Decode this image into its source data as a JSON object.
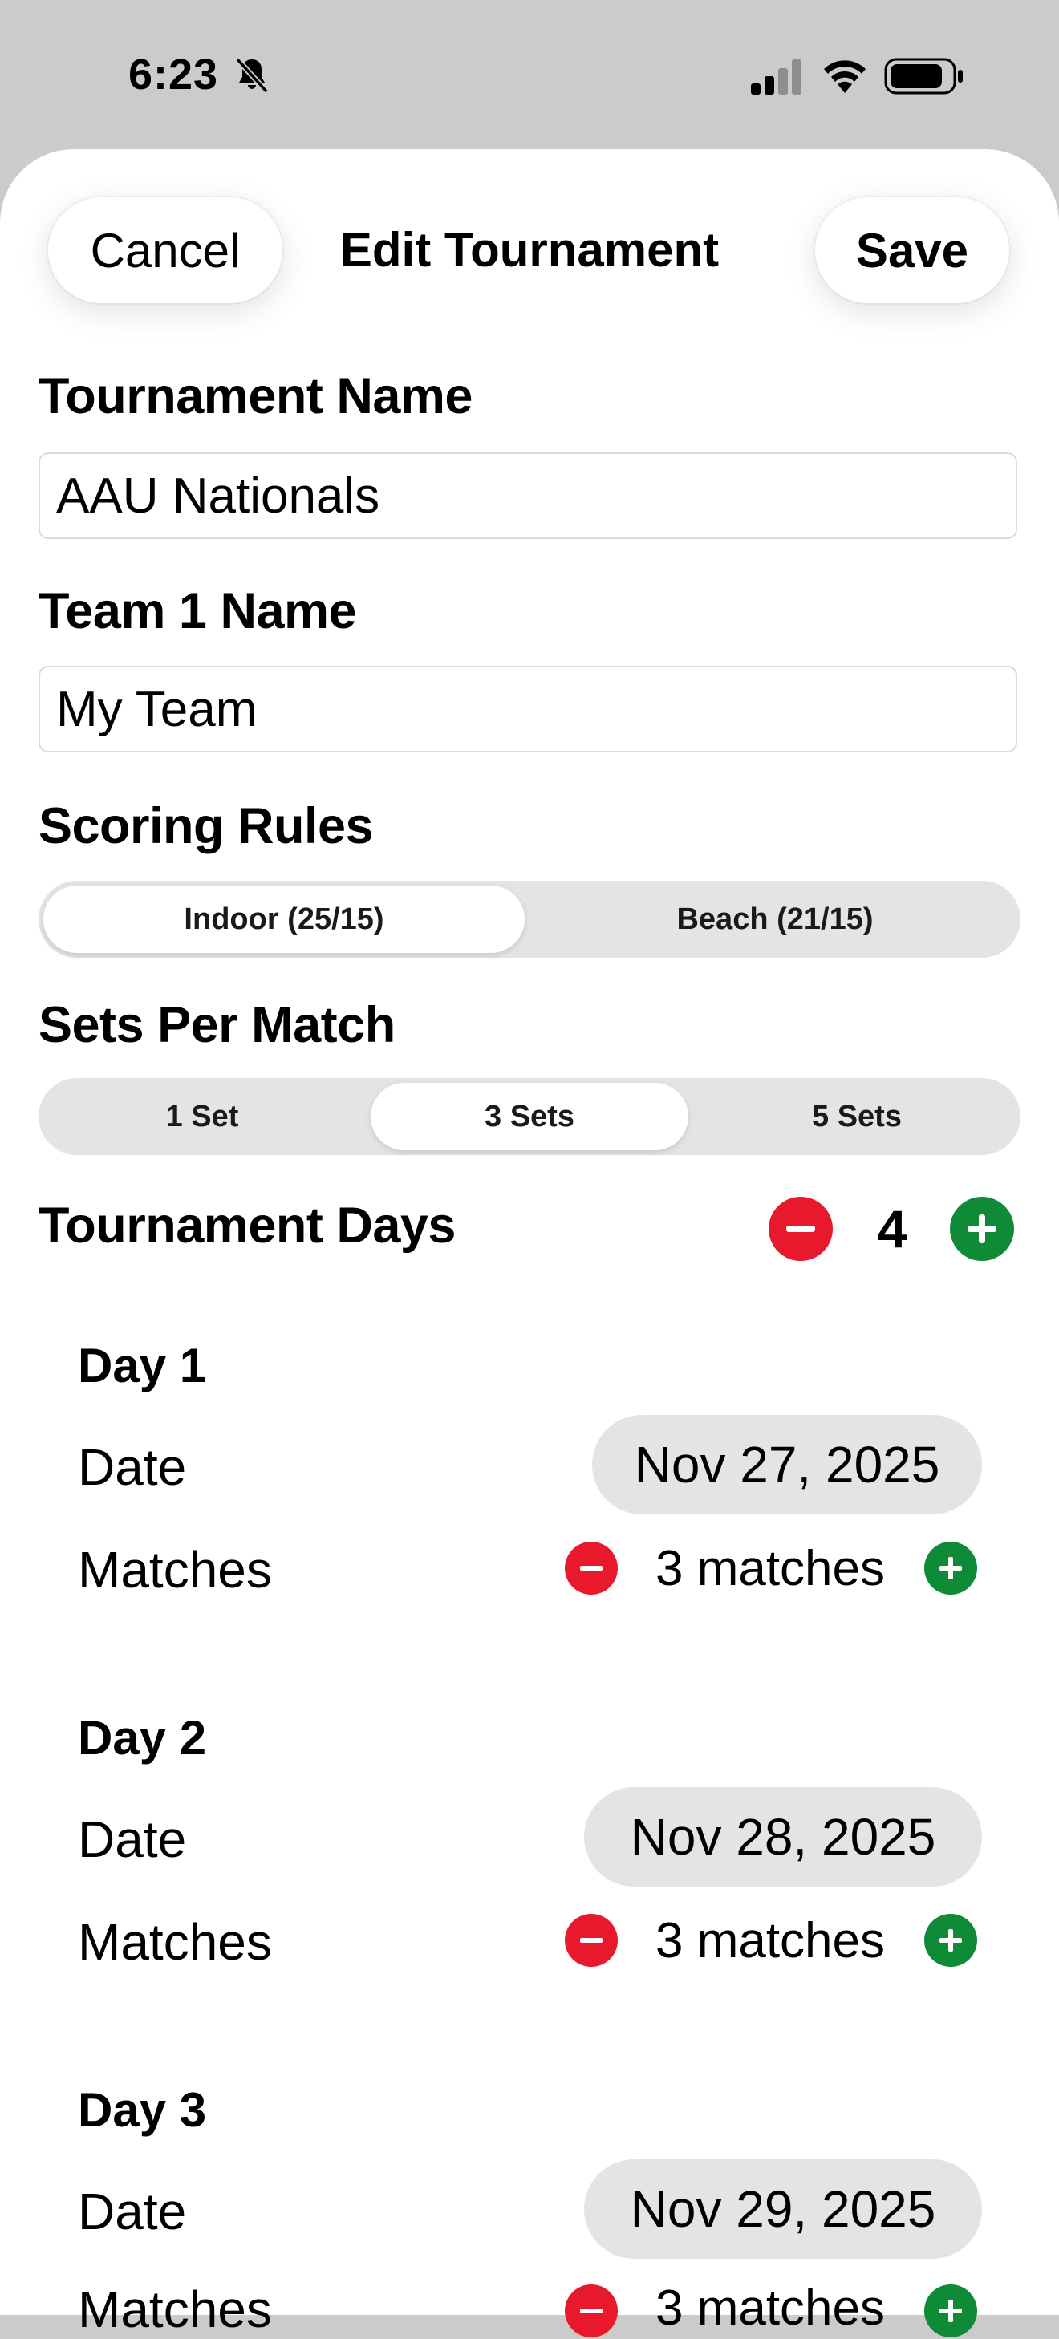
{
  "status_bar": {
    "time": "6:23",
    "icons": [
      "bell-slash-icon",
      "cellular-signal-icon",
      "wifi-icon",
      "battery-icon"
    ]
  },
  "nav": {
    "cancel_label": "Cancel",
    "title": "Edit Tournament",
    "save_label": "Save"
  },
  "form": {
    "tournament_name_label": "Tournament Name",
    "tournament_name_value": "AAU Nationals",
    "team1_name_label": "Team 1 Name",
    "team1_name_value": "My Team",
    "scoring_rules_label": "Scoring Rules",
    "scoring_rules_options": [
      "Indoor (25/15)",
      "Beach (21/15)"
    ],
    "scoring_rules_selected": "Indoor (25/15)",
    "sets_per_match_label": "Sets Per Match",
    "sets_per_match_options": [
      "1 Set",
      "3 Sets",
      "5 Sets"
    ],
    "sets_per_match_selected": "3 Sets",
    "tournament_days_label": "Tournament Days",
    "tournament_days_count": "4"
  },
  "days": [
    {
      "title": "Day 1",
      "date_label": "Date",
      "date": "Nov 27, 2025",
      "matches_label": "Matches",
      "matches": "3 matches"
    },
    {
      "title": "Day 2",
      "date_label": "Date",
      "date": "Nov 28, 2025",
      "matches_label": "Matches",
      "matches": "3 matches"
    },
    {
      "title": "Day 3",
      "date_label": "Date",
      "date": "Nov 29, 2025",
      "matches_label": "Matches",
      "matches": "3 matches"
    }
  ],
  "colors": {
    "minus_button": "#e8192c",
    "plus_button": "#0f8a37",
    "background": "#cbcbcb",
    "sheet": "#ffffff",
    "segment_track": "#e4e4e4"
  }
}
